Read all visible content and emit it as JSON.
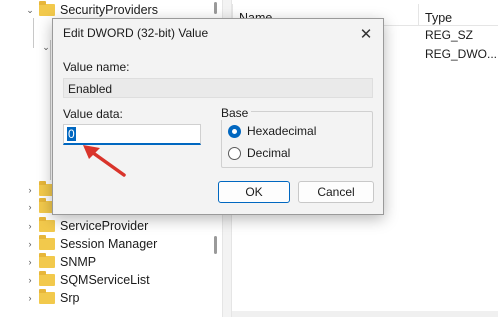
{
  "tree": {
    "items": [
      {
        "label": "SecurityProviders",
        "expanded": true
      },
      {
        "label": "",
        "expanded": true
      },
      {
        "label": "ServiceProvider",
        "expanded": false
      },
      {
        "label": "Session Manager",
        "expanded": false
      },
      {
        "label": "SNMP",
        "expanded": false
      },
      {
        "label": "SQMServiceList",
        "expanded": false
      },
      {
        "label": "Srp",
        "expanded": false
      }
    ]
  },
  "list": {
    "columns": [
      "Name",
      "Type"
    ],
    "rows": [
      {
        "type": "REG_SZ"
      },
      {
        "type": "REG_DWO..."
      }
    ]
  },
  "dialog": {
    "title": "Edit DWORD (32-bit) Value",
    "close_glyph": "✕",
    "value_name_label": "Value name:",
    "value_name": "Enabled",
    "value_data_label": "Value data:",
    "value_data": "0",
    "base_label": "Base",
    "base_options": [
      {
        "label": "Hexadecimal",
        "selected": true
      },
      {
        "label": "Decimal",
        "selected": false
      }
    ],
    "ok_label": "OK",
    "cancel_label": "Cancel"
  },
  "colors": {
    "accent": "#0067c0",
    "annotation_arrow": "#d9342b",
    "folder": "#f2c94c"
  }
}
